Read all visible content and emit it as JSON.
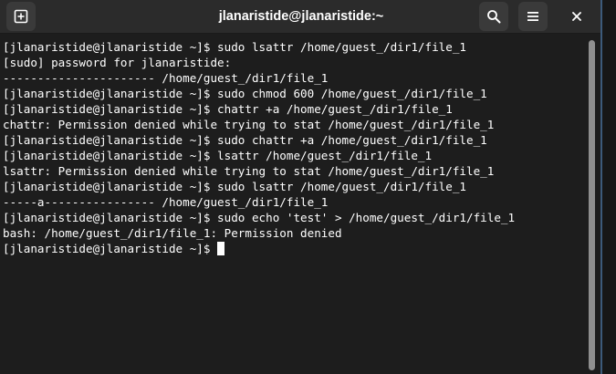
{
  "window": {
    "title": "jlanaristide@jlanaristide:~"
  },
  "titlebar": {
    "new_tab_icon": "new-tab-icon",
    "search_icon": "search-icon",
    "menu_icon": "hamburger-menu-icon",
    "close_icon": "close-icon"
  },
  "terminal": {
    "lines": [
      "[jlanaristide@jlanaristide ~]$ sudo lsattr /home/guest_/dir1/file_1",
      "[sudo] password for jlanaristide:",
      "---------------------- /home/guest_/dir1/file_1",
      "[jlanaristide@jlanaristide ~]$ sudo chmod 600 /home/guest_/dir1/file_1",
      "[jlanaristide@jlanaristide ~]$ chattr +a /home/guest_/dir1/file_1",
      "chattr: Permission denied while trying to stat /home/guest_/dir1/file_1",
      "[jlanaristide@jlanaristide ~]$ sudo chattr +a /home/guest_/dir1/file_1",
      "[jlanaristide@jlanaristide ~]$ lsattr /home/guest_/dir1/file_1",
      "lsattr: Permission denied while trying to stat /home/guest_/dir1/file_1",
      "[jlanaristide@jlanaristide ~]$ sudo lsattr /home/guest_/dir1/file_1",
      "-----a---------------- /home/guest_/dir1/file_1",
      "[jlanaristide@jlanaristide ~]$ sudo echo 'test' > /home/guest_/dir1/file_1",
      "bash: /home/guest_/dir1/file_1: Permission denied"
    ],
    "prompt": "[jlanaristide@jlanaristide ~]$ "
  },
  "colors": {
    "background": "#1d1d1d",
    "titlebar": "#2b2b2b",
    "text": "#ffffff"
  }
}
